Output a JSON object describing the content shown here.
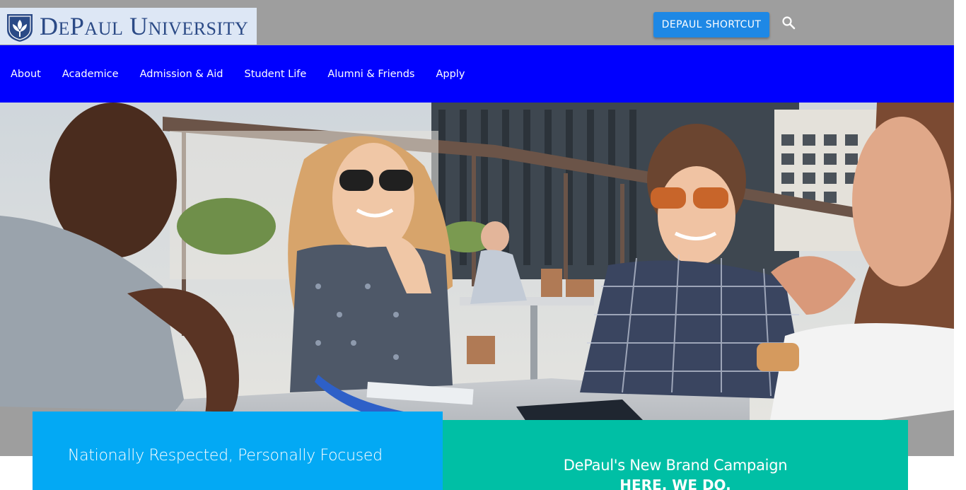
{
  "header": {
    "logo_text": "DEPAUL UNIVERSITY",
    "shortcut_label": "DEPAUL SHORTCUT",
    "search_icon": "search-icon"
  },
  "nav": {
    "items": [
      {
        "label": "About"
      },
      {
        "label": "Academice"
      },
      {
        "label": "Admission & Aid"
      },
      {
        "label": "Student Life"
      },
      {
        "label": "Alumni & Friends"
      },
      {
        "label": "Apply"
      }
    ]
  },
  "cards": {
    "left": {
      "title": "Nationally Respected, Personally Focused"
    },
    "right": {
      "title": "DePaul's New Brand Campaign",
      "subtitle": "HERE. WE DO."
    }
  },
  "colors": {
    "top_bar": "#9e9e9e",
    "nav_bar": "#0000ff",
    "shortcut_button": "#1e88e5",
    "card_left": "#03a9f4",
    "card_right": "#00bfa5",
    "logo_text": "#2b4a86"
  }
}
